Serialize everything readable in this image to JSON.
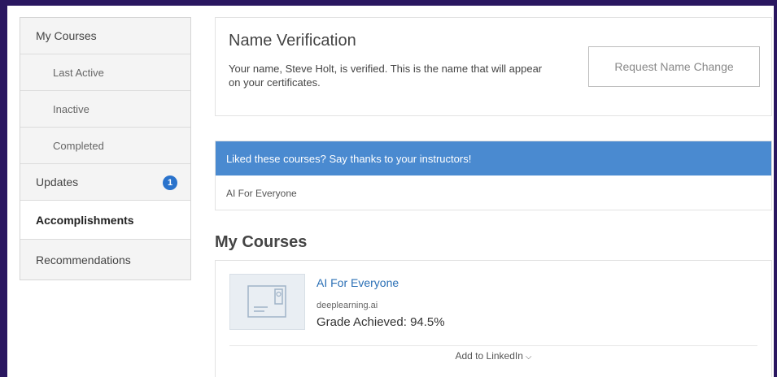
{
  "sidebar": {
    "items": [
      {
        "label": "My Courses"
      },
      {
        "label": "Last Active"
      },
      {
        "label": "Inactive"
      },
      {
        "label": "Completed"
      },
      {
        "label": "Updates",
        "badge": "1"
      },
      {
        "label": "Accomplishments"
      },
      {
        "label": "Recommendations"
      }
    ]
  },
  "name_verification": {
    "title": "Name Verification",
    "text": "Your name, Steve Holt, is verified. This is the name that will appear on your certificates.",
    "button": "Request Name Change"
  },
  "thanks": {
    "header": "Liked these courses? Say thanks to your instructors!",
    "course": "AI For Everyone"
  },
  "my_courses": {
    "title": "My Courses",
    "course": {
      "name": "AI For Everyone",
      "org": "deeplearning.ai",
      "grade": "Grade Achieved: 94.5%",
      "linkedin": "Add to LinkedIn"
    }
  },
  "colors": {
    "accent": "#4a8ad0",
    "badge": "#2a73cc",
    "link": "#2a6fb5",
    "frame": "#2a1760"
  }
}
